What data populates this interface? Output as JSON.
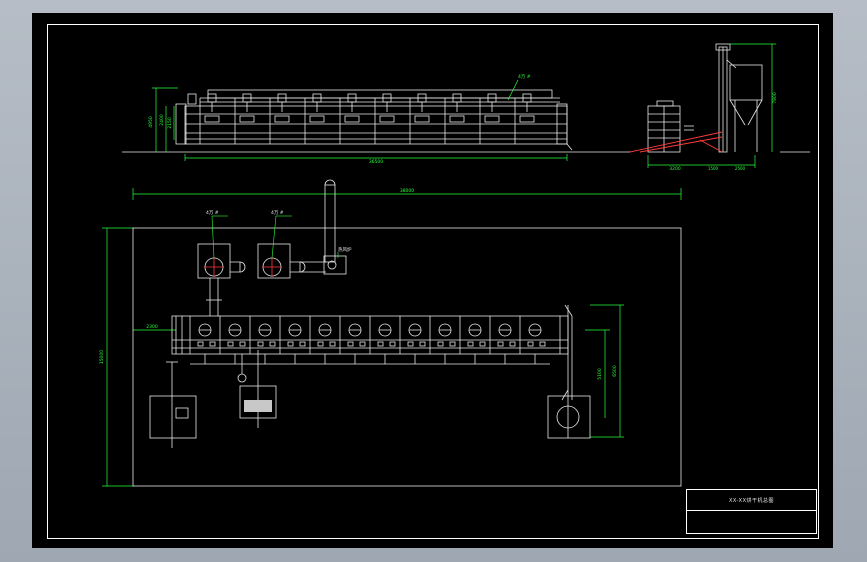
{
  "drawing": {
    "frame_color": "#ffffff",
    "dimension_color": "#29ff3a",
    "geometry_color": "#e8e8e8",
    "accent_color": "#ff3b3b",
    "title_block": {
      "title": "XX-XX烘干机总图"
    },
    "elevation": {
      "overall_length": "36500",
      "overall_height": "4950",
      "height_1": "2400",
      "height_2": "2150",
      "callout": "4万 #",
      "feeder_base_length": "3200",
      "elevator_height": "7800",
      "elevator_dim_a": "1500",
      "elevator_dim_b": "2500"
    },
    "plan": {
      "overall_length": "38000",
      "overall_width": "15000",
      "left_offset": "2300",
      "fan_label_1": "4万 #",
      "fan_label_2": "4万 #",
      "stove_label": "热风炉",
      "right_dim_1": "5100",
      "right_dim_2": "6500"
    }
  }
}
